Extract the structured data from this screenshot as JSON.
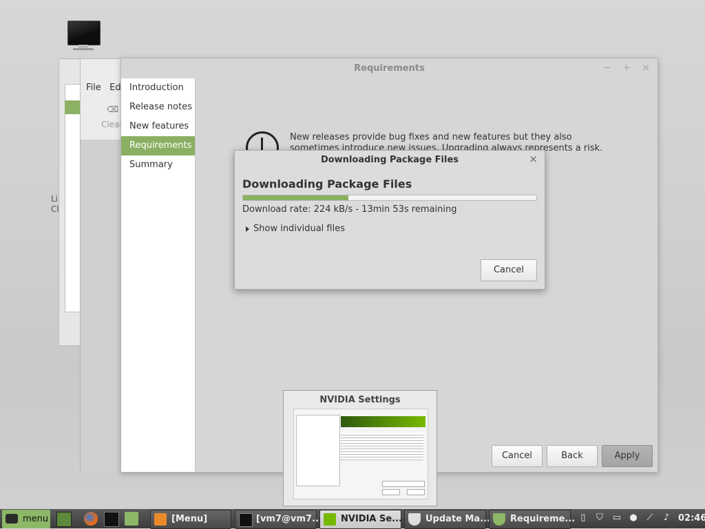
{
  "background_windows": {
    "menu_file": "File",
    "menu_edit": "Edi",
    "clear_label": "Clear",
    "side_text_line1": "Li",
    "side_text_line2": "Cl"
  },
  "main_window": {
    "title": "Requirements",
    "controls": {
      "minimize": "−",
      "maximize": "+",
      "close": "×"
    },
    "sidebar": [
      {
        "label": "Introduction",
        "active": false
      },
      {
        "label": "Release notes",
        "active": false
      },
      {
        "label": "New features",
        "active": false
      },
      {
        "label": "Requirements",
        "active": true
      },
      {
        "label": "Summary",
        "active": false
      }
    ],
    "body_text": "New releases provide bug fixes and new features but they also sometimes introduce new issues. Upgrading always represents a risk. Your data is safe",
    "buttons": {
      "cancel": "Cancel",
      "back": "Back",
      "apply": "Apply"
    }
  },
  "download_dialog": {
    "title": "Downloading Package Files",
    "close": "×",
    "heading": "Downloading Package Files",
    "progress_fraction": 0.36,
    "rate_text": "Download rate: 224 kB/s - 13min 53s remaining",
    "expander_label": "Show individual files",
    "cancel_label": "Cancel"
  },
  "thumbnail_popup": {
    "title": "NVIDIA Settings"
  },
  "taskbar": {
    "menu_label": "menu",
    "tasks": [
      {
        "label": "[Menu]",
        "icon": "menu-app-icon",
        "active": false
      },
      {
        "label": "[vm7@vm7...",
        "icon": "terminal-icon",
        "active": false
      },
      {
        "label": "NVIDIA Se...",
        "icon": "nvidia-icon",
        "active": true
      },
      {
        "label": "Update Ma...",
        "icon": "shield-icon",
        "active": false
      },
      {
        "label": "Requireme...",
        "icon": "shield-check-icon",
        "active": false
      }
    ],
    "clock": "02:46"
  },
  "colors": {
    "accent_green": "#8aaf62",
    "progress_green": "#8ab15f"
  }
}
